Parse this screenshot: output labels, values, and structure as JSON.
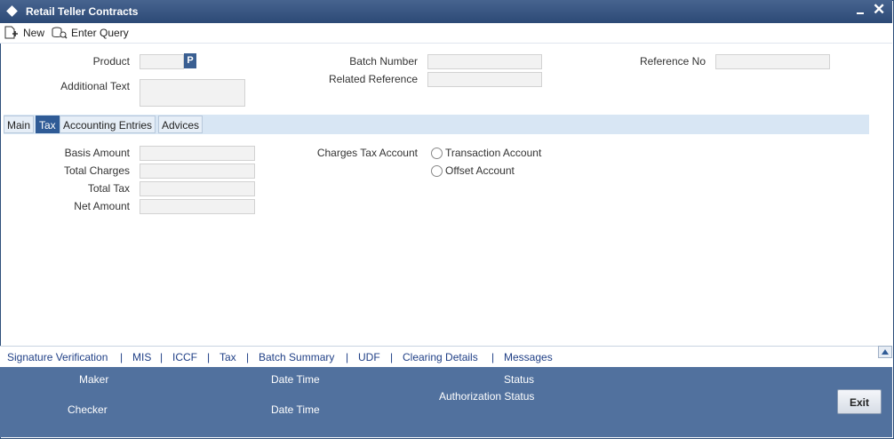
{
  "window": {
    "title": "Retail Teller Contracts"
  },
  "toolbar": {
    "new_label": "New",
    "enter_query_label": "Enter Query"
  },
  "header": {
    "product_label": "Product",
    "p_button": "P",
    "additional_text_label": "Additional Text",
    "batch_number_label": "Batch Number",
    "related_reference_label": "Related Reference",
    "reference_no_label": "Reference No"
  },
  "tabs": [
    {
      "label": "Main"
    },
    {
      "label": "Tax"
    },
    {
      "label": "Accounting Entries"
    },
    {
      "label": "Advices"
    }
  ],
  "tax": {
    "basis_amount_label": "Basis Amount",
    "total_charges_label": "Total Charges",
    "total_tax_label": "Total Tax",
    "net_amount_label": "Net Amount",
    "charges_tax_account_label": "Charges Tax Account",
    "option_transaction": "Transaction Account",
    "option_offset": "Offset Account"
  },
  "links": [
    "Signature Verification",
    "MIS",
    "ICCF",
    "Tax",
    "Batch Summary",
    "UDF",
    "Clearing Details",
    "Messages"
  ],
  "footer": {
    "maker_label": "Maker",
    "checker_label": "Checker",
    "date_time_label_1": "Date Time",
    "date_time_label_2": "Date Time",
    "status_label": "Status",
    "authorization_status_label": "Authorization Status",
    "exit_label": "Exit"
  }
}
